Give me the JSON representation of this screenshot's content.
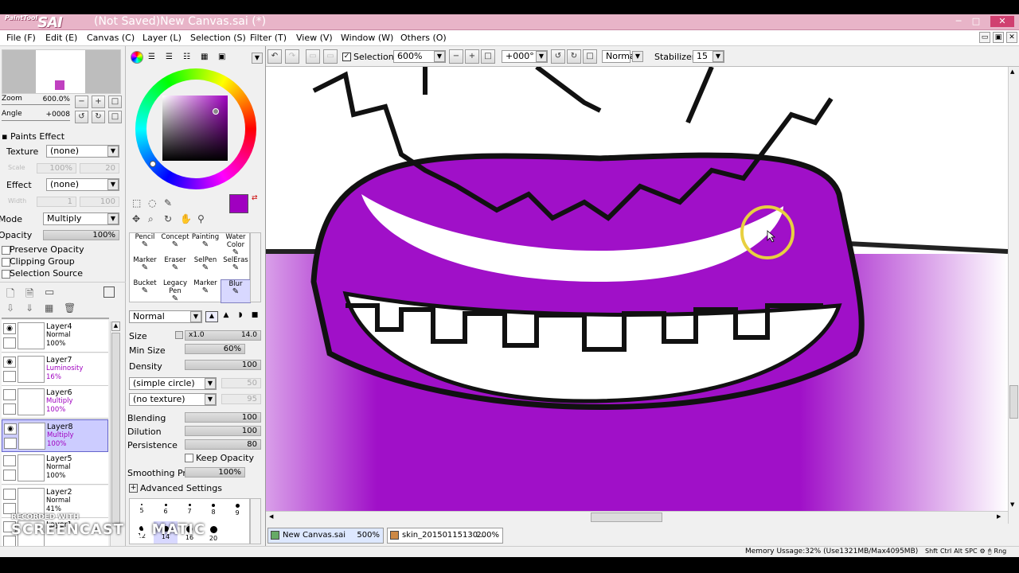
{
  "window": {
    "app_logo": "PaintTool",
    "app_logo_big": "SAI",
    "title": "(Not Saved)New Canvas.sai (*)",
    "min": "─",
    "max": "□",
    "close": "✕"
  },
  "menu": [
    "File (F)",
    "Edit (E)",
    "Canvas (C)",
    "Layer (L)",
    "Selection (S)",
    "Filter (T)",
    "View (V)",
    "Window (W)",
    "Others (O)"
  ],
  "mdi": {
    "min": "▭",
    "max": "▣",
    "close": "✕"
  },
  "navigator": {
    "zoom_label": "Zoom",
    "zoom_value": "600.0%",
    "angle_label": "Angle",
    "angle_value": "+0008"
  },
  "paints_effect": {
    "header": "Paints Effect",
    "texture_label": "Texture",
    "texture_value": "(none)",
    "scale_label": "Scale",
    "scale_value": "100%",
    "scale_num": "20",
    "effect_label": "Effect",
    "effect_value": "(none)",
    "width_label": "Width",
    "width_value": "1",
    "width_num": "100"
  },
  "layer_props": {
    "mode_label": "Mode",
    "mode_value": "Multiply",
    "opacity_label": "Opacity",
    "opacity_value": "100%",
    "preserve_opacity": "Preserve Opacity",
    "clipping_group": "Clipping Group",
    "selection_source": "Selection Source"
  },
  "layers": [
    {
      "name": "Layer4",
      "mode": "Normal",
      "opacity": "100%",
      "visible": true,
      "selected": false,
      "mode_color": "#000000"
    },
    {
      "name": "Layer7",
      "mode": "Luminosity",
      "opacity": "16%",
      "visible": true,
      "selected": false,
      "mode_color": "#a000c0"
    },
    {
      "name": "Layer6",
      "mode": "Multiply",
      "opacity": "100%",
      "visible": false,
      "selected": false,
      "mode_color": "#a000c0"
    },
    {
      "name": "Layer8",
      "mode": "Multiply",
      "opacity": "100%",
      "visible": true,
      "selected": true,
      "mode_color": "#a000c0"
    },
    {
      "name": "Layer5",
      "mode": "Normal",
      "opacity": "100%",
      "visible": false,
      "selected": false,
      "mode_color": "#000000"
    },
    {
      "name": "Layer2",
      "mode": "Normal",
      "opacity": "41%",
      "visible": false,
      "selected": false,
      "mode_color": "#000000"
    },
    {
      "name": "Layer1",
      "mode": "",
      "opacity": "",
      "visible": false,
      "selected": false,
      "mode_color": "#000000"
    }
  ],
  "colors": {
    "primary": "#a000c0",
    "secondary": "#ffffff",
    "canvas_purple": "#a010c8"
  },
  "tools": [
    {
      "name": "Pencil",
      "line2": ""
    },
    {
      "name": "Concept",
      "line2": ""
    },
    {
      "name": "Painting",
      "line2": ""
    },
    {
      "name": "Water",
      "line2": "Color"
    },
    {
      "name": "Marker",
      "line2": ""
    },
    {
      "name": "Eraser",
      "line2": ""
    },
    {
      "name": "SelPen",
      "line2": ""
    },
    {
      "name": "SelEras",
      "line2": ""
    },
    {
      "name": "Bucket",
      "line2": ""
    },
    {
      "name": "Legacy",
      "line2": "Pen"
    },
    {
      "name": "Marker",
      "line2": ""
    },
    {
      "name": "Blur",
      "line2": ""
    }
  ],
  "brush": {
    "blend_mode": "Normal",
    "size_label": "Size",
    "size_mult": "x1.0",
    "size_value": "14.0",
    "minsize_label": "Min Size",
    "minsize_value": "60%",
    "density_label": "Density",
    "density_value": "100",
    "shape": "(simple circle)",
    "shape_num": "50",
    "texture": "(no texture)",
    "texture_num": "95",
    "blending_label": "Blending",
    "blending_value": "100",
    "dilution_label": "Dilution",
    "dilution_value": "100",
    "persistence_label": "Persistence",
    "persistence_value": "80",
    "keep_opacity": "Keep Opacity",
    "smoothing_label": "Smoothing Prs",
    "smoothing_value": "100%",
    "advanced": "Advanced Settings"
  },
  "brush_sizes": [
    "5",
    "6",
    "7",
    "8",
    "9",
    "12",
    "14",
    "16",
    "20"
  ],
  "toolbar": {
    "selection_label": "Selection",
    "zoom": "600%",
    "angle": "+000°",
    "blend": "Normal",
    "stabilizer_label": "Stabilizer",
    "stabilizer_value": "15"
  },
  "tabs": [
    {
      "label": "New Canvas.sai",
      "zoom": "500%"
    },
    {
      "label": "skin_20150115130...",
      "zoom": "200%"
    }
  ],
  "status": {
    "memory": "Memory Ussage:32% (Use1321MB/Max4095MB)",
    "keys": [
      "Shft",
      "Ctrl",
      "Alt",
      "SPC"
    ],
    "rng": "Rng"
  },
  "watermark": {
    "top": "RECORDED WITH",
    "bottom_left": "SCREENCAST",
    "bottom_right": "MATIC"
  }
}
